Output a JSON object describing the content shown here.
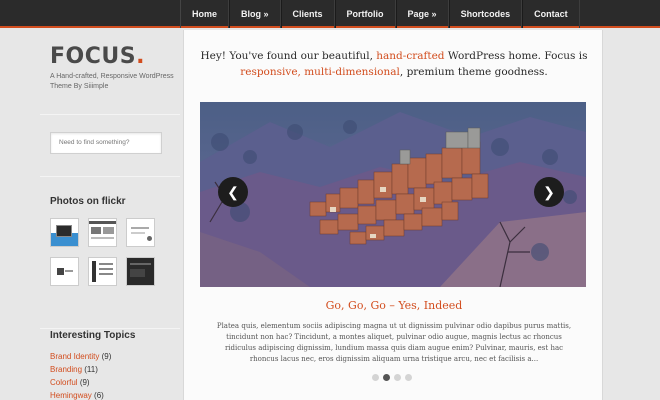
{
  "nav": {
    "items": [
      {
        "label": "Home"
      },
      {
        "label": "Blog »"
      },
      {
        "label": "Clients"
      },
      {
        "label": "Portfolio"
      },
      {
        "label": "Page »"
      },
      {
        "label": "Shortcodes"
      },
      {
        "label": "Contact"
      }
    ]
  },
  "sidebar": {
    "logo": {
      "text": "FOCUS",
      "dot": "."
    },
    "tagline": "A Hand-crafted, Responsive WordPress Theme By Siiimple",
    "search": {
      "placeholder": "Need to find something?"
    },
    "flickr": {
      "title": "Photos on flickr",
      "thumb_count": 6
    },
    "topics": {
      "title": "Interesting Topics",
      "items": [
        {
          "name": "Brand Identity",
          "count": "(9)"
        },
        {
          "name": "Branding",
          "count": "(11)"
        },
        {
          "name": "Colorful",
          "count": "(9)"
        },
        {
          "name": "Hemingway",
          "count": "(6)"
        }
      ]
    }
  },
  "main": {
    "intro": {
      "part1": "Hey! You've found our beautiful, ",
      "hl1": "hand-crafted",
      "part2": " WordPress home. Focus is ",
      "hl2": "responsive, multi-dimensional",
      "part3": ", premium theme goodness."
    },
    "slider": {
      "prev_icon": "chevron-left-icon",
      "next_icon": "chevron-right-icon",
      "active_index": 1,
      "dot_count": 4
    },
    "slide": {
      "title": "Go, Go, Go – Yes, Indeed",
      "text": "Platea quis, elementum sociis adipiscing magna ut ut dignissim pulvinar odio dapibus purus mattis, tincidunt non hac? Tincidunt, a montes aliquet, pulvinar odio augue, magnis lectus ac rhoncus ridiculus adipiscing dignissim, lundium massa quis diam augue enim? Pulvinar, mauris, est hac rhoncus lacus nec, eros dignissim aliquam urna tristique arcu, nec et facilisis a..."
    }
  },
  "colors": {
    "accent": "#d24d1e",
    "nav_bg": "#2b2b2b",
    "page_bg": "#e7e7e7"
  }
}
